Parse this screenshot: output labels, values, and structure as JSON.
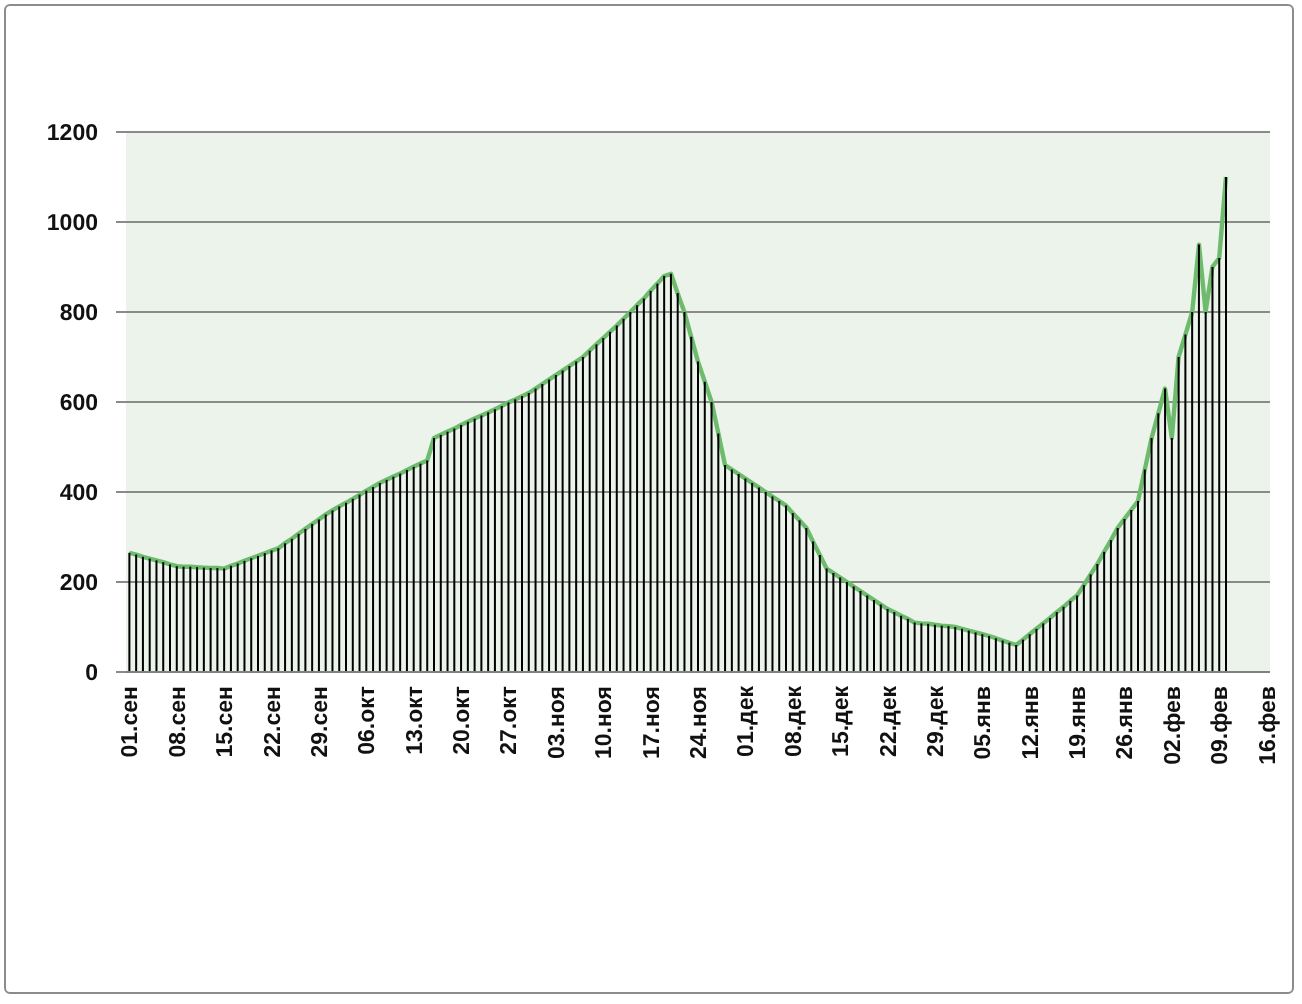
{
  "chart_data": {
    "type": "bar",
    "grid": true,
    "yticks": [
      0,
      200,
      400,
      600,
      800,
      1000,
      1200
    ],
    "ylim": [
      0,
      1200
    ],
    "categories": [
      "01.сен",
      null,
      null,
      null,
      null,
      null,
      null,
      "08.сен",
      null,
      null,
      null,
      null,
      null,
      null,
      "15.сен",
      null,
      null,
      null,
      null,
      null,
      null,
      "22.сен",
      null,
      null,
      null,
      null,
      null,
      null,
      "29.сен",
      null,
      null,
      null,
      null,
      null,
      null,
      "06.окт",
      null,
      null,
      null,
      null,
      null,
      null,
      "13.окт",
      null,
      null,
      null,
      null,
      null,
      null,
      "20.окт",
      null,
      null,
      null,
      null,
      null,
      null,
      "27.окт",
      null,
      null,
      null,
      null,
      null,
      null,
      "03.ноя",
      null,
      null,
      null,
      null,
      null,
      null,
      "10.ноя",
      null,
      null,
      null,
      null,
      null,
      null,
      "17.ноя",
      null,
      null,
      null,
      null,
      null,
      null,
      "24.ноя",
      null,
      null,
      null,
      null,
      null,
      null,
      "01.дек",
      null,
      null,
      null,
      null,
      null,
      null,
      "08.дек",
      null,
      null,
      null,
      null,
      null,
      null,
      "15.дек",
      null,
      null,
      null,
      null,
      null,
      null,
      "22.дек",
      null,
      null,
      null,
      null,
      null,
      null,
      "29.дек",
      null,
      null,
      null,
      null,
      null,
      null,
      "05.янв",
      null,
      null,
      null,
      null,
      null,
      null,
      "12.янв",
      null,
      null,
      null,
      null,
      null,
      null,
      "19.янв",
      null,
      null,
      null,
      null,
      null,
      null,
      "26.янв",
      null,
      null,
      null,
      null,
      null,
      null,
      "02.фев",
      null,
      null,
      null,
      null,
      null,
      null,
      "09.фев",
      null,
      null,
      null,
      null,
      null,
      null,
      "16.фев"
    ],
    "series": [
      {
        "type": "bar",
        "color": "#000000",
        "values": [
          265,
          261,
          256,
          252,
          248,
          244,
          239,
          235,
          234,
          234,
          233,
          232,
          231,
          231,
          230,
          236,
          241,
          247,
          253,
          258,
          264,
          270,
          275,
          286,
          296,
          307,
          318,
          329,
          339,
          350,
          359,
          368,
          376,
          385,
          394,
          403,
          411,
          420,
          427,
          434,
          441,
          449,
          456,
          463,
          470,
          520,
          527,
          534,
          541,
          549,
          556,
          563,
          570,
          577,
          584,
          591,
          599,
          606,
          613,
          620,
          630,
          640,
          650,
          660,
          670,
          680,
          690,
          700,
          714,
          728,
          742,
          756,
          770,
          785,
          800,
          815,
          830,
          847,
          863,
          880,
          885,
          842,
          800,
          745,
          690,
          645,
          600,
          530,
          460,
          450,
          440,
          430,
          420,
          410,
          400,
          390,
          380,
          370,
          353,
          337,
          320,
          290,
          260,
          230,
          220,
          210,
          200,
          190,
          180,
          170,
          160,
          150,
          140,
          133,
          125,
          118,
          110,
          108,
          107,
          105,
          103,
          102,
          100,
          96,
          92,
          88,
          84,
          80,
          75,
          70,
          65,
          60,
          72,
          84,
          96,
          108,
          120,
          133,
          145,
          158,
          170,
          193,
          217,
          240,
          267,
          293,
          320,
          340,
          360,
          380,
          450,
          520,
          575,
          630,
          520,
          700,
          750,
          800,
          950,
          800,
          900,
          920,
          1100,
          null,
          null,
          null,
          null,
          null,
          null
        ]
      },
      {
        "type": "line",
        "color": "#6dbb6d",
        "values": [
          265,
          261,
          256,
          252,
          248,
          244,
          239,
          235,
          234,
          234,
          233,
          232,
          231,
          231,
          230,
          236,
          241,
          247,
          253,
          258,
          264,
          270,
          275,
          286,
          296,
          307,
          318,
          329,
          339,
          350,
          359,
          368,
          376,
          385,
          394,
          403,
          411,
          420,
          427,
          434,
          441,
          449,
          456,
          463,
          470,
          520,
          527,
          534,
          541,
          549,
          556,
          563,
          570,
          577,
          584,
          591,
          599,
          606,
          613,
          620,
          630,
          640,
          650,
          660,
          670,
          680,
          690,
          700,
          714,
          728,
          742,
          756,
          770,
          785,
          800,
          815,
          830,
          847,
          863,
          880,
          885,
          842,
          800,
          745,
          690,
          645,
          600,
          530,
          460,
          450,
          440,
          430,
          420,
          410,
          400,
          390,
          380,
          370,
          353,
          337,
          320,
          290,
          260,
          230,
          220,
          210,
          200,
          190,
          180,
          170,
          160,
          150,
          140,
          133,
          125,
          118,
          110,
          108,
          107,
          105,
          103,
          102,
          100,
          96,
          92,
          88,
          84,
          80,
          75,
          70,
          65,
          60,
          72,
          84,
          96,
          108,
          120,
          133,
          145,
          158,
          170,
          193,
          217,
          240,
          267,
          293,
          320,
          340,
          360,
          380,
          450,
          520,
          575,
          630,
          520,
          700,
          750,
          800,
          950,
          800,
          900,
          920,
          1100,
          null,
          null,
          null,
          null,
          null,
          null
        ]
      }
    ]
  }
}
